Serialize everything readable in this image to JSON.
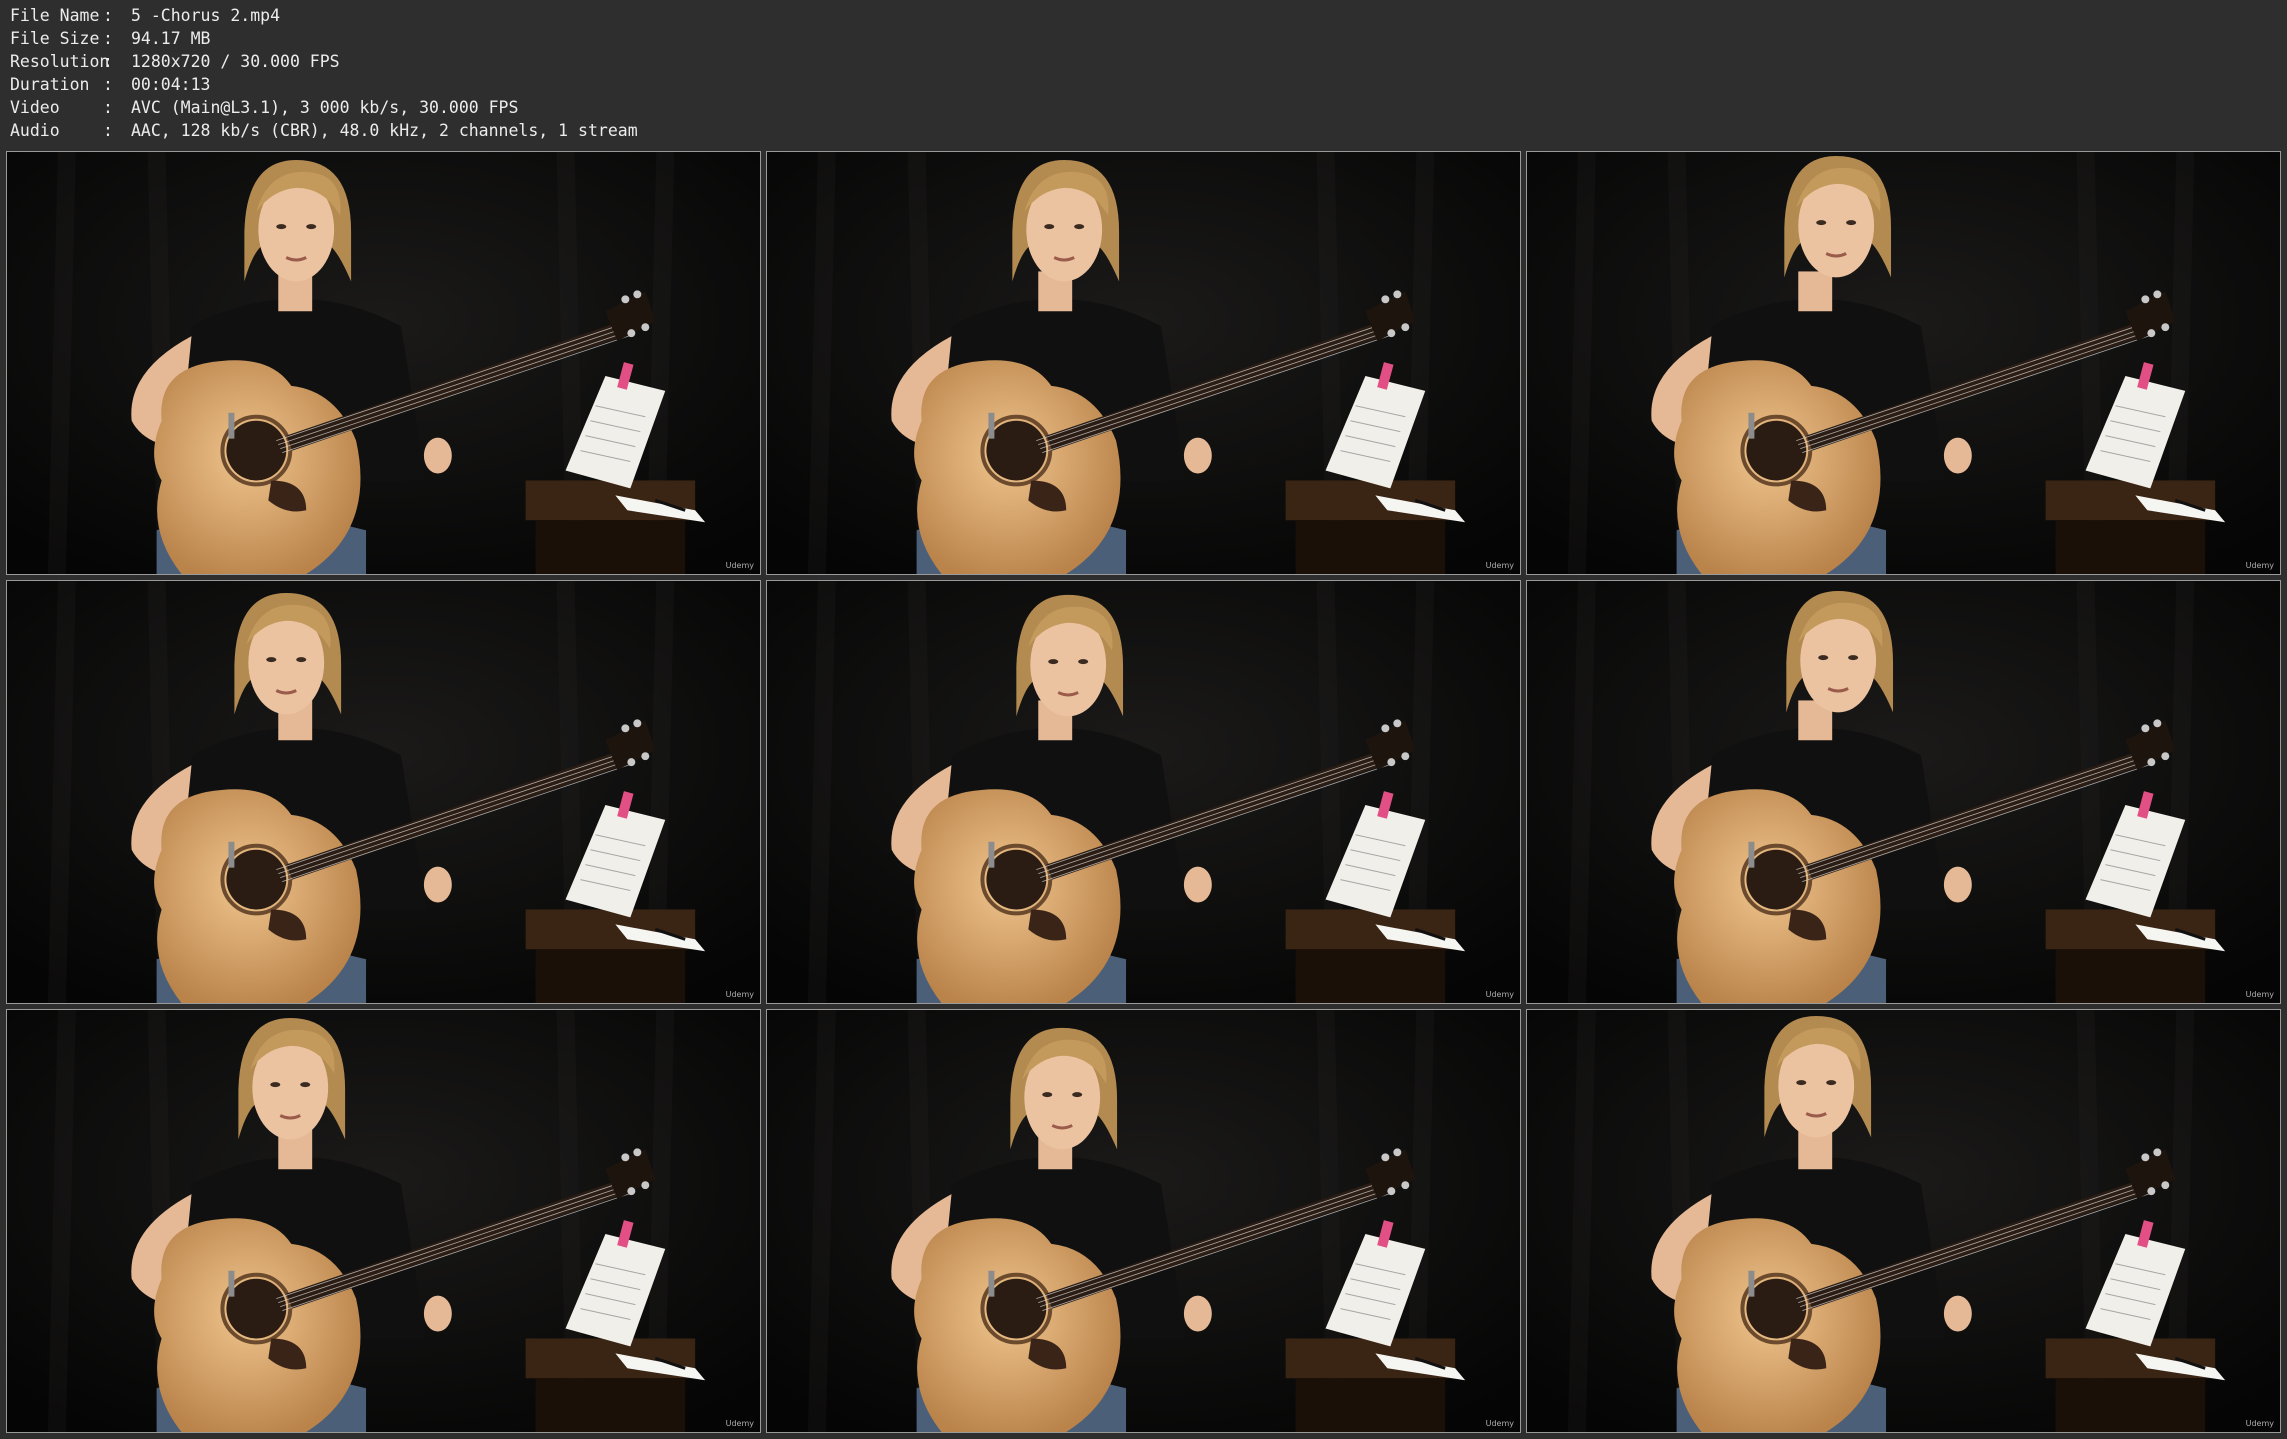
{
  "media_info": [
    {
      "label": "File Name",
      "value": "5 -Chorus 2.mp4"
    },
    {
      "label": "File Size",
      "value": "94.17 MB"
    },
    {
      "label": "Resolution",
      "value": "1280x720 / 30.000 FPS"
    },
    {
      "label": "Duration",
      "value": "00:04:13"
    },
    {
      "label": "Video",
      "value": "AVC (Main@L3.1), 3 000 kb/s, 30.000 FPS"
    },
    {
      "label": "Audio",
      "value": "AAC, 128 kb/s (CBR), 48.0 kHz, 2 channels, 1 stream"
    }
  ],
  "thumbnails": {
    "count": 9,
    "watermark": "Udemy",
    "subject": "man-playing-acoustic-guitar-thumbnail"
  },
  "colors": {
    "background": "#2e2e2e",
    "text": "#ececec",
    "frame_border": "#9a9a9a"
  }
}
